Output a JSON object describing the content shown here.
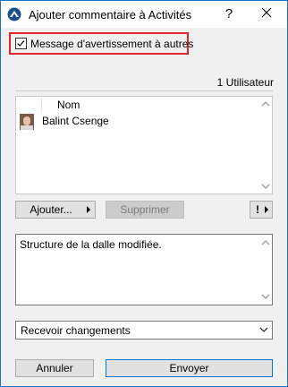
{
  "window": {
    "title": "Ajouter commentaire à Activités",
    "help_label": "?"
  },
  "notify": {
    "label": "Message d'avertissement à autres",
    "checked": true
  },
  "users": {
    "count_label": "1 Utilisateur",
    "column_header": "Nom",
    "rows": [
      {
        "name": "Balint Csenge"
      }
    ]
  },
  "list_buttons": {
    "add_label": "Ajouter...",
    "remove_label": "Supprimer",
    "priority_label": "!"
  },
  "comment": {
    "text": "Structure de la dalle modifiée."
  },
  "mode_select": {
    "value": "Recevoir changements"
  },
  "footer": {
    "cancel_label": "Annuler",
    "send_label": "Envoyer"
  },
  "colors": {
    "accent": "#0078d7",
    "highlight_border": "#e0252b"
  }
}
